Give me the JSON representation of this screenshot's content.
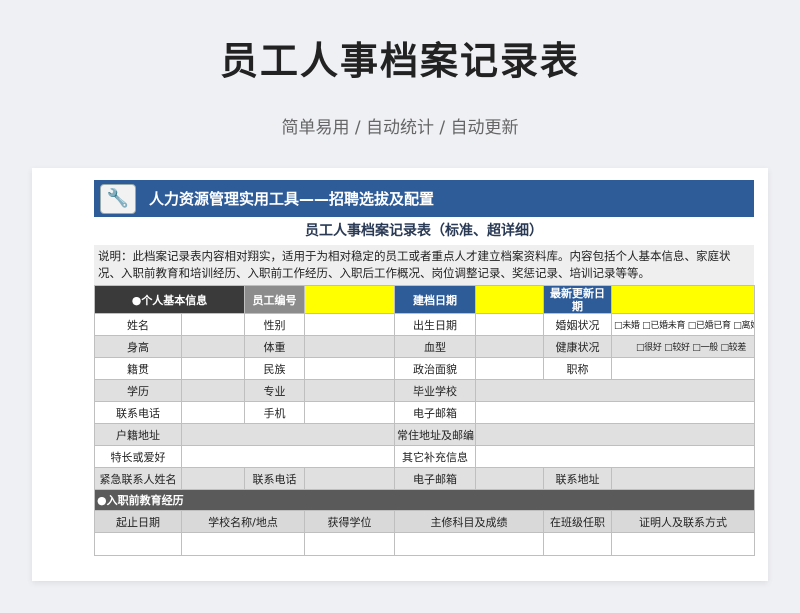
{
  "page": {
    "title": "员工人事档案记录表",
    "subtitle": "简单易用 / 自动统计 / 自动更新"
  },
  "banner": {
    "text": "人力资源管理实用工具——招聘选拔及配置",
    "icon": "wrench-icon"
  },
  "sheet": {
    "title": "员工人事档案记录表（标准、超详细）",
    "description": "说明：此档案记录表内容相对翔实，适用于为相对稳定的员工或者重点人才建立档案资料库。内容包括个人基本信息、家庭状况、入职前教育和培训经历、入职前工作经历、入职后工作概况、岗位调整记录、奖惩记录、培训记录等等。"
  },
  "basic": {
    "section": "个人基本信息",
    "emp_no": "员工编号",
    "file_date": "建档日期",
    "last_update": "最新更新日期",
    "name": "姓名",
    "gender": "性别",
    "birth": "出生日期",
    "marital": "婚姻状况",
    "marital_options": "□未婚 □已婚未育 □已婚已育 □离婚",
    "height": "身高",
    "weight": "体重",
    "blood": "血型",
    "health": "健康状况",
    "health_options": "□很好 □较好 □一般 □较差",
    "origin": "籍贯",
    "ethnicity": "民族",
    "political": "政治面貌",
    "title": "职称",
    "education": "学历",
    "major": "专业",
    "school": "毕业学校",
    "phone": "联系电话",
    "mobile": "手机",
    "email": "电子邮箱",
    "hukou": "户籍地址",
    "address": "常住地址及邮编",
    "hobby": "特长或爱好",
    "other": "其它补充信息",
    "emergency": "紧急联系人姓名",
    "em_phone": "联系电话",
    "em_email": "电子邮箱",
    "em_address": "联系地址"
  },
  "education": {
    "section": "入职前教育经历",
    "cols": [
      "起止日期",
      "学校名称/地点",
      "获得学位",
      "主修科目及成绩",
      "在班级任职",
      "证明人及联系方式"
    ]
  },
  "colors": {
    "banner": "#2e5c99",
    "highlight": "#ffff00",
    "section_dark": "#3a3a3a"
  }
}
